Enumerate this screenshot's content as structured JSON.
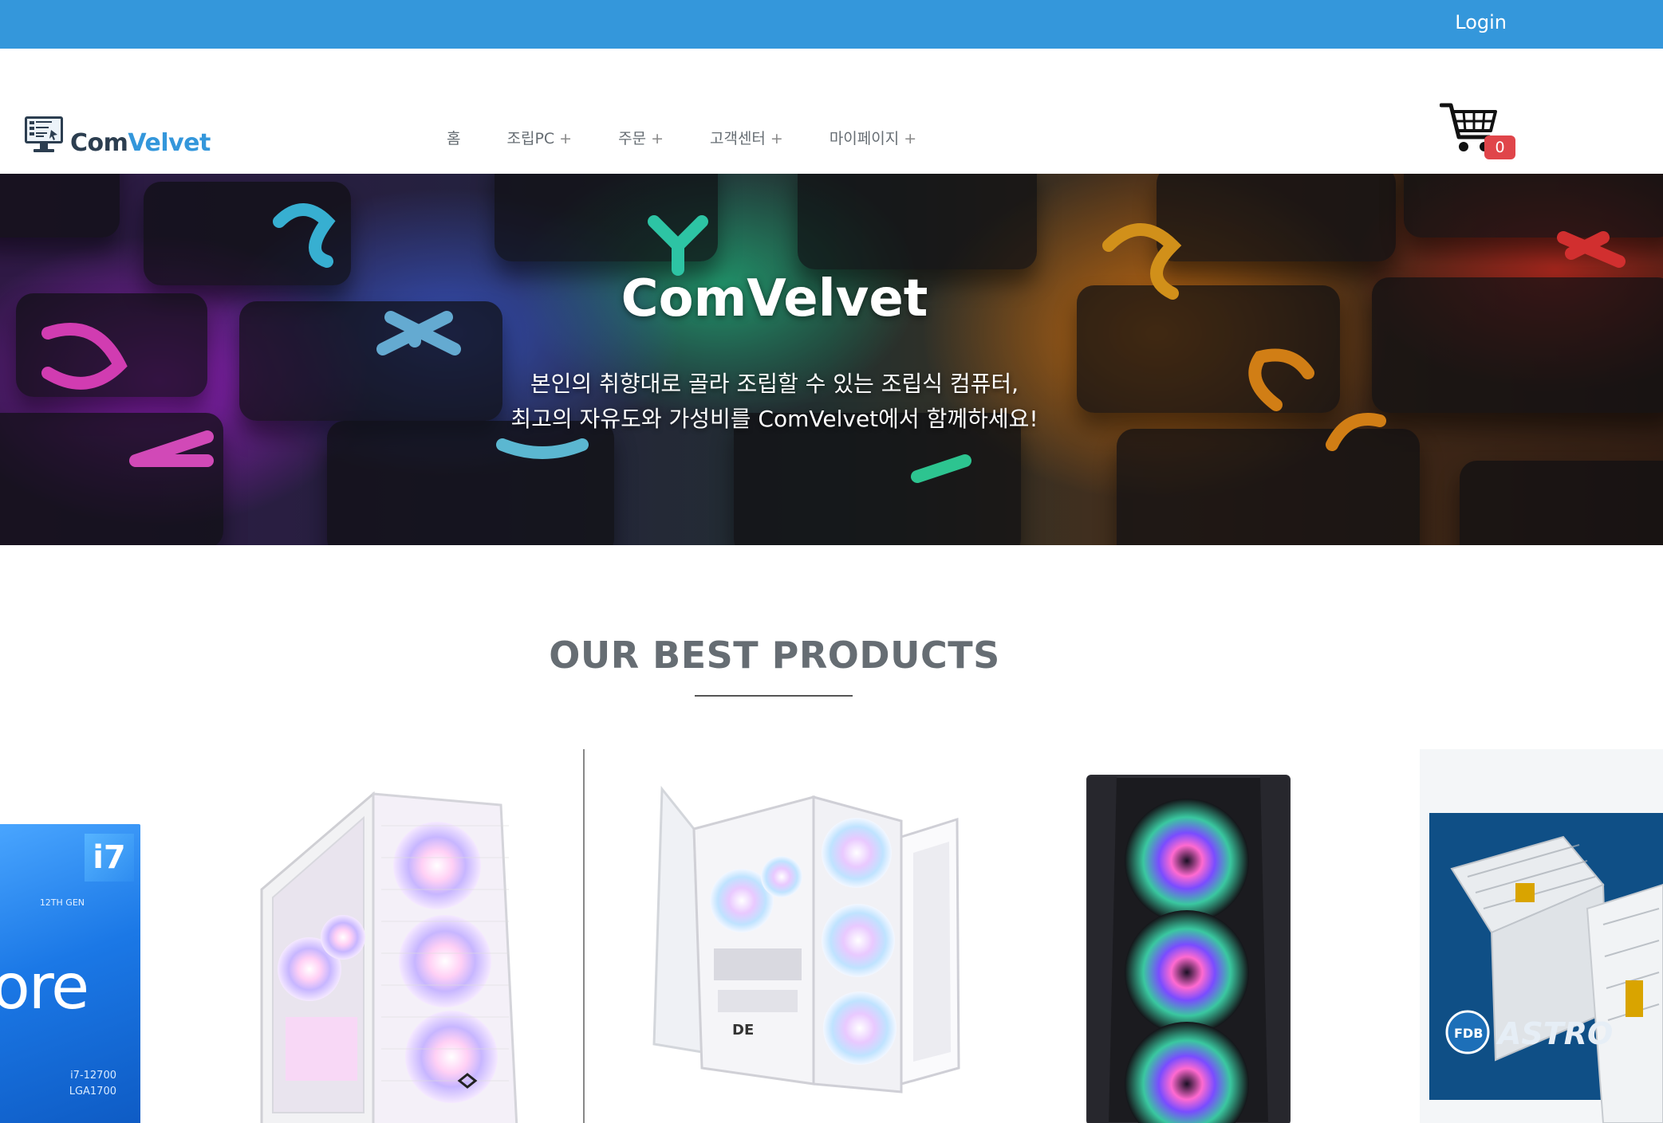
{
  "topbar": {
    "login_label": "Login",
    "color": "#3497db"
  },
  "brand": {
    "part1": "Com",
    "part2": "Velvet",
    "icon": "computer-monitor-icon"
  },
  "nav": {
    "items": [
      {
        "label": "홈",
        "has_submenu": false
      },
      {
        "label": "조립PC",
        "has_submenu": true
      },
      {
        "label": "주문",
        "has_submenu": true
      },
      {
        "label": "고객센터",
        "has_submenu": true
      },
      {
        "label": "마이페이지",
        "has_submenu": true
      }
    ],
    "plus": "+"
  },
  "cart": {
    "icon": "shopping-cart-icon",
    "count": "0"
  },
  "hero": {
    "title": "ComVelvet",
    "subtitle_line1": "본인의 취향대로 골라 조립할 수 있는 조립식 컴퓨터,",
    "subtitle_line2": "최고의 자유도와 가성비를 ComVelvet에서 함께하세요!"
  },
  "section": {
    "title": "OUR BEST PRODUCTS"
  },
  "products": {
    "cpu": {
      "badge": "i7",
      "gen": "12TH GEN",
      "brand_text": "ore",
      "model_line1": "i7-12700",
      "model_line2": "LGA1700"
    },
    "psu": {
      "fdb": "FDB",
      "astro": "ASTRO"
    },
    "case3_logo": "DE"
  },
  "colors": {
    "accent": "#3497db",
    "nav_text": "#666d73",
    "badge": "#e0454a"
  }
}
